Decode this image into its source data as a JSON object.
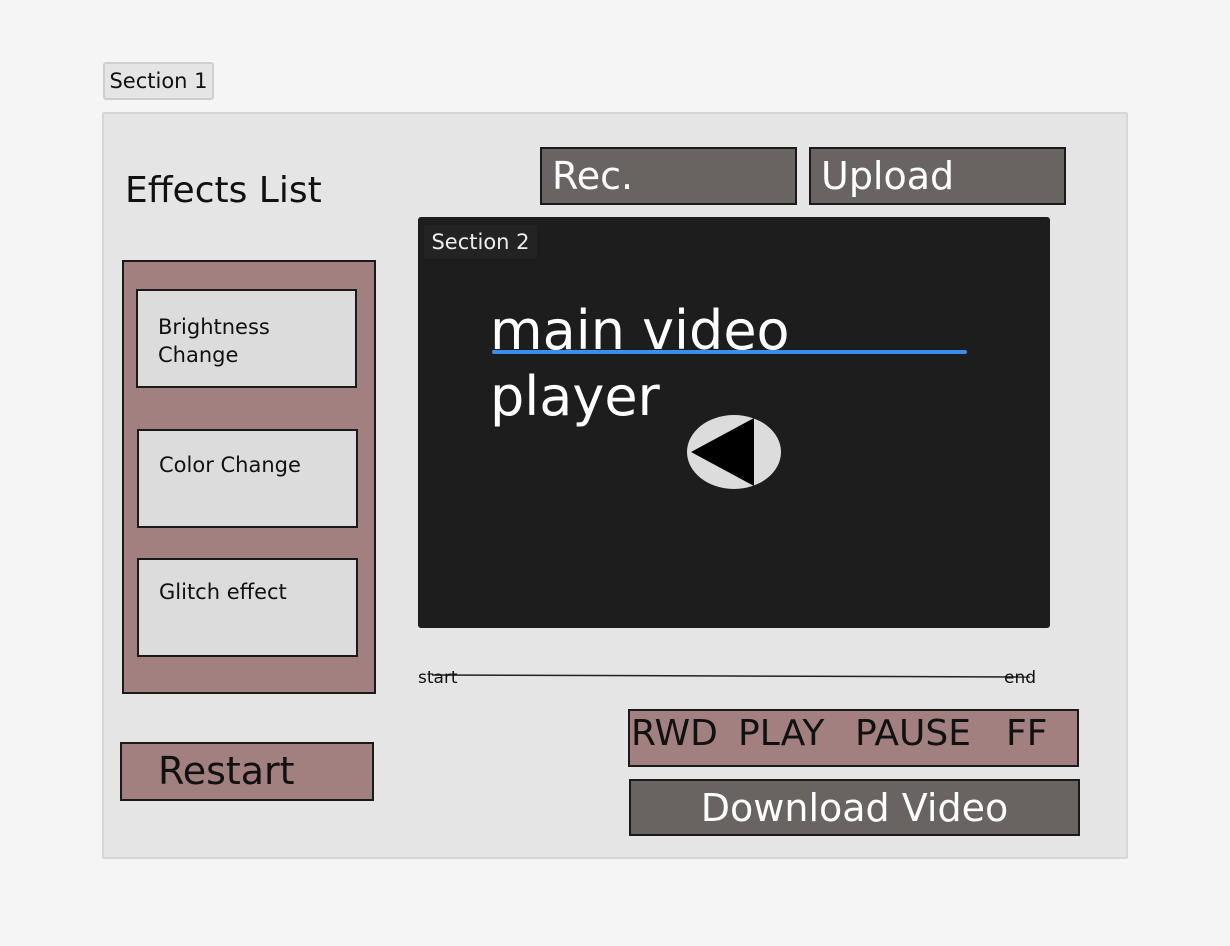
{
  "section1": {
    "label": "Section 1"
  },
  "effects": {
    "heading": "Effects List",
    "items": [
      {
        "label": "Brightness Change"
      },
      {
        "label": "Color Change"
      },
      {
        "label": "Glitch effect"
      }
    ]
  },
  "controls": {
    "restart_label": "Restart",
    "rec_label": "Rec.",
    "upload_label": "Upload",
    "download_label": "Download Video"
  },
  "video": {
    "section_label": "Section 2",
    "title": "main video player",
    "play_icon": "play-icon",
    "accent_color": "#3d8ee8"
  },
  "timeline": {
    "start_label": "start",
    "end_label": "end"
  },
  "transport": {
    "rwd_label": "RWD",
    "play_label": "PLAY",
    "pause_label": "PAUSE",
    "ff_label": "FF"
  },
  "colors": {
    "panel_pink": "#a28080",
    "button_gray": "#696462",
    "video_bg": "#1e1d1e"
  }
}
